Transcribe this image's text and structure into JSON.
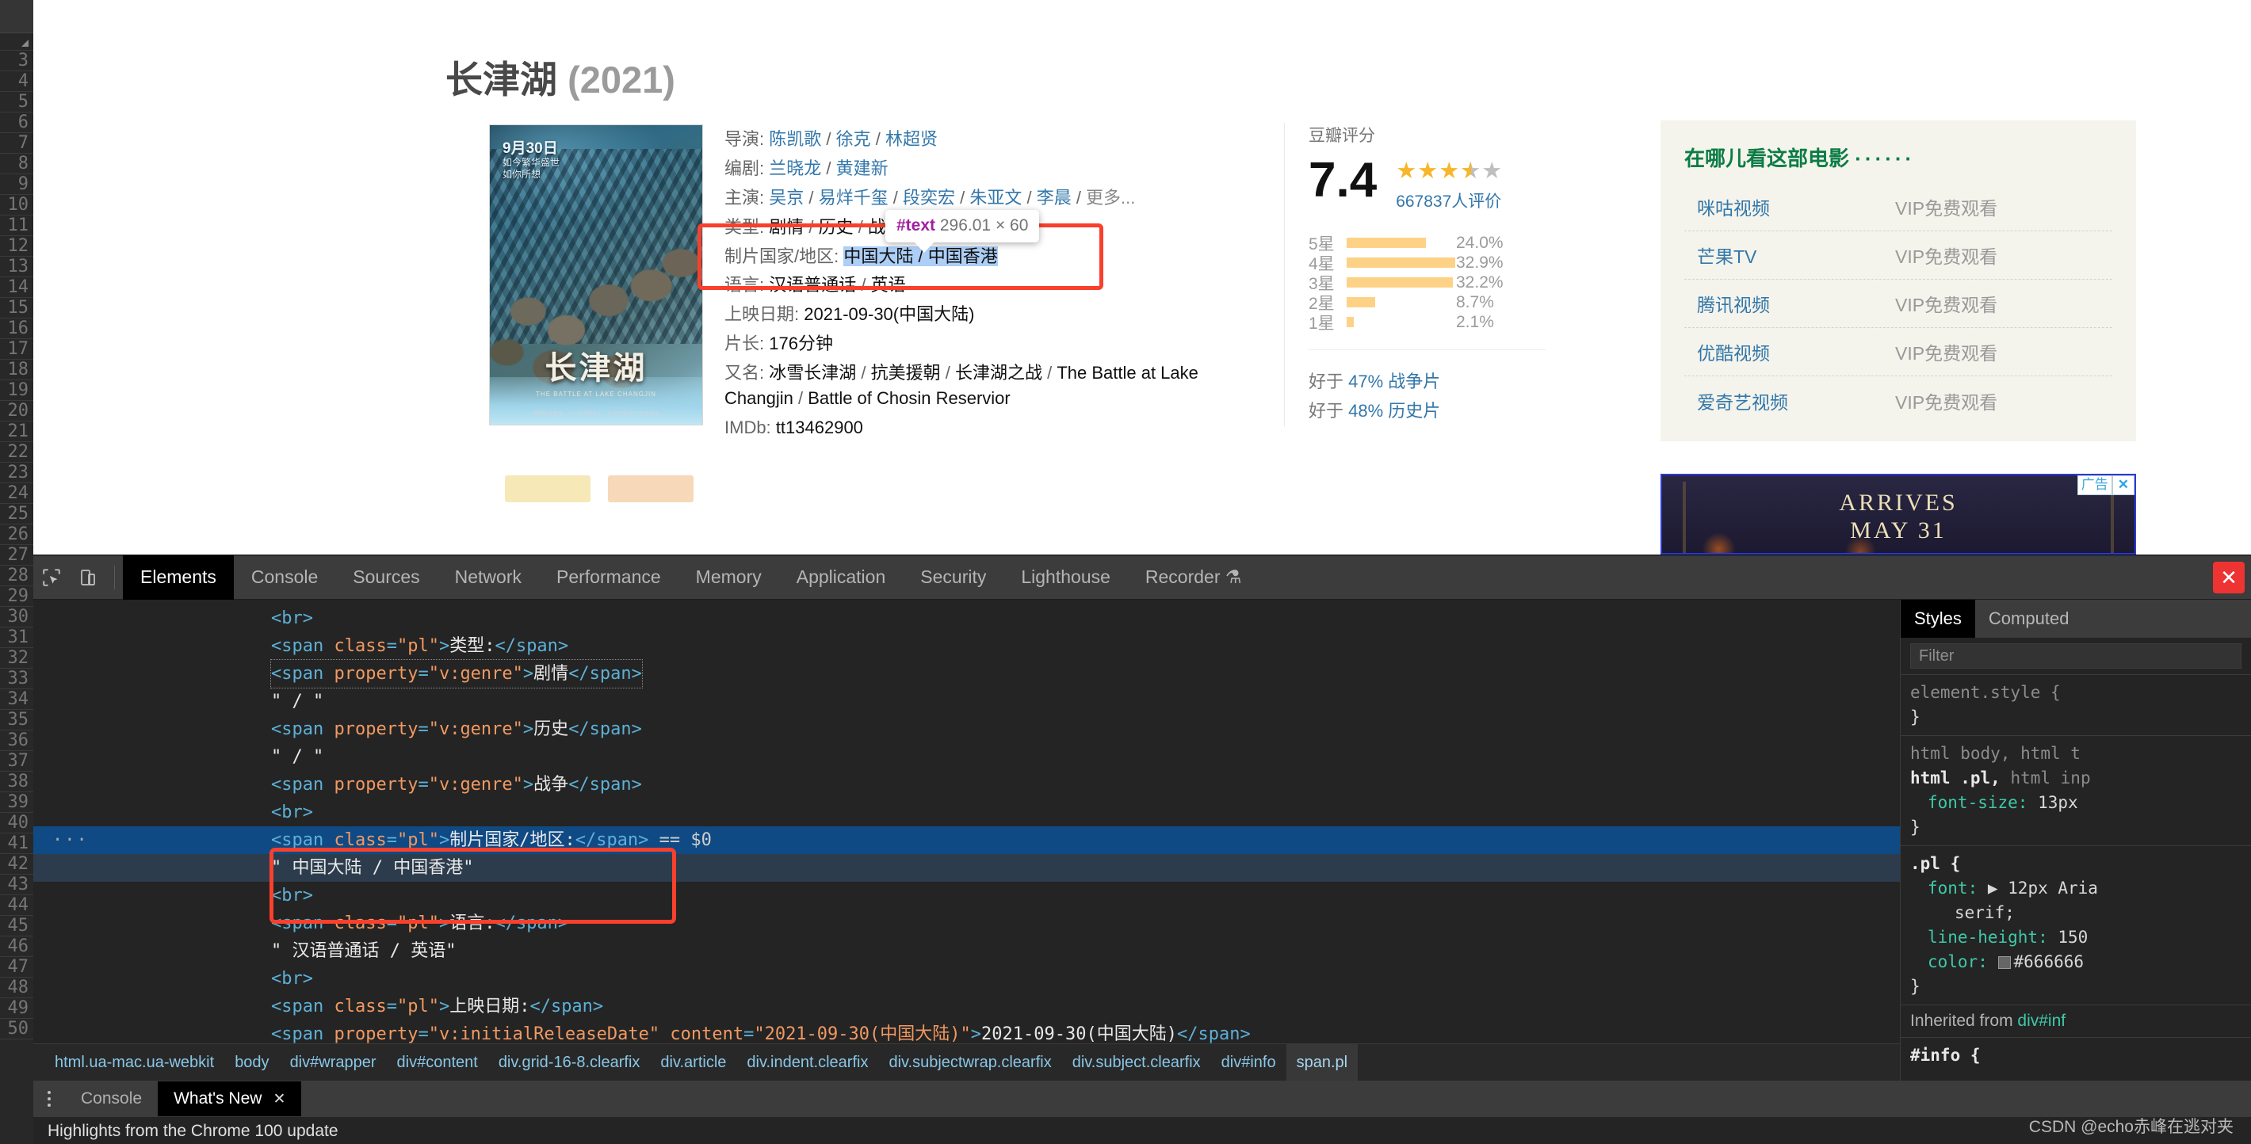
{
  "page": {
    "title_zh": "长津湖",
    "title_year": "(2021)",
    "poster": {
      "date": "9月30日",
      "tagline_line1": "如今繁华盛世",
      "tagline_line2": "如你所想",
      "logo": "长津湖",
      "english": "THE BATTLE AT LAKE CHANGJIN",
      "credits": "博纳影业集团 · 八一电影制片厂 · 华夏电影发行 联合出品"
    },
    "info": [
      {
        "label": "导演:",
        "values": [
          "陈凯歌",
          "徐克",
          "林超贤"
        ],
        "link": true
      },
      {
        "label": "编剧:",
        "values": [
          "兰晓龙",
          "黄建新"
        ],
        "link": true
      },
      {
        "label": "主演:",
        "values": [
          "吴京",
          "易烊千玺",
          "段奕宏",
          "朱亚文",
          "李晨"
        ],
        "more": "更多...",
        "link": true
      },
      {
        "label": "类型:",
        "values": [
          "剧情",
          "历史",
          "战争"
        ],
        "link": false
      },
      {
        "label": "制片国家/地区:",
        "values": [
          "中国大陆",
          "中国香港"
        ],
        "link": false,
        "selected": true
      },
      {
        "label": "语言:",
        "values": [
          "汉语普通话",
          "英语"
        ],
        "link": false
      },
      {
        "label": "上映日期:",
        "values": [
          "2021-09-30(中国大陆)"
        ],
        "link": false
      },
      {
        "label": "片长:",
        "values": [
          "176分钟"
        ],
        "link": false
      },
      {
        "label": "又名:",
        "values": [
          "冰雪长津湖",
          "抗美援朝",
          "长津湖之战",
          "The Battle at Lake Changjin",
          "Battle of Chosin Reservior"
        ],
        "link": false
      },
      {
        "label": "IMDb:",
        "values": [
          "tt13462900"
        ],
        "link": false
      }
    ],
    "tooltip": {
      "node_name": "#text",
      "dimensions": "296.01 × 60"
    },
    "rating": {
      "heading": "豆瓣评分",
      "score": "7.4",
      "stars_filled": 3,
      "stars_half": 1,
      "stars_empty": 1,
      "count_label": "667837人评价",
      "distribution": [
        {
          "label": "5星",
          "percent": "24.0%",
          "width": 24.0
        },
        {
          "label": "4星",
          "percent": "32.9%",
          "width": 32.9
        },
        {
          "label": "3星",
          "percent": "32.2%",
          "width": 32.2
        },
        {
          "label": "2星",
          "percent": "8.7%",
          "width": 8.7
        },
        {
          "label": "1星",
          "percent": "2.1%",
          "width": 2.1
        }
      ],
      "better_than": [
        {
          "prefix": "好于",
          "value": "47%",
          "suffix": "战争片"
        },
        {
          "prefix": "好于",
          "value": "48%",
          "suffix": "历史片"
        }
      ]
    },
    "watch": {
      "title": "在哪儿看这部电影",
      "dots": "······",
      "rows": [
        {
          "name": "咪咕视频",
          "price": "VIP免费观看"
        },
        {
          "name": "芒果TV",
          "price": "VIP免费观看"
        },
        {
          "name": "腾讯视频",
          "price": "VIP免费观看"
        },
        {
          "name": "优酷视频",
          "price": "VIP免费观看"
        },
        {
          "name": "爱奇艺视频",
          "price": "VIP免费观看"
        }
      ]
    },
    "ad": {
      "line1": "ARRIVES",
      "line2": "MAY 31",
      "badge": "广告",
      "close": "✕"
    }
  },
  "devtools": {
    "tabs": [
      "Elements",
      "Console",
      "Sources",
      "Network",
      "Performance",
      "Memory",
      "Application",
      "Security",
      "Lighthouse",
      "Recorder"
    ],
    "active_tab": "Elements",
    "recorder_suffix": "⚗",
    "close_icon": "✕",
    "gutter_numbers": [
      "3",
      "4",
      "5",
      "6",
      "7",
      "8",
      "9",
      "10",
      "11",
      "12",
      "13",
      "14",
      "15",
      "16",
      "17",
      "18",
      "19",
      "20",
      "21",
      "22",
      "23",
      "24",
      "25",
      "26",
      "27",
      "28",
      "29",
      "30",
      "31",
      "32",
      "33",
      "34",
      "35",
      "36",
      "37",
      "38",
      "39",
      "40",
      "41",
      "42",
      "43",
      "44",
      "45",
      "46",
      "47",
      "48",
      "49",
      "50"
    ],
    "dom": {
      "lines": [
        {
          "n": 26,
          "html": "<span class=\"tag\">&lt;br&gt;</span>",
          "state": "dim"
        },
        {
          "n": 27,
          "html": "<span class=\"tag\">&lt;span </span><span class=\"attr\">class</span><span class=\"tag\">=</span><span class=\"val\">\"pl\"</span><span class=\"tag\">&gt;</span><span class=\"txt\">类型:</span><span class=\"tag\">&lt;/span&gt;</span>"
        },
        {
          "n": 28,
          "html": "<span class=\"dotted\"><span class=\"tag\">&lt;span </span><span class=\"attr\">property</span><span class=\"tag\">=</span><span class=\"val\">\"v:genre\"</span><span class=\"tag\">&gt;</span><span class=\"txt\">剧情</span><span class=\"tag\">&lt;/span&gt;</span></span>"
        },
        {
          "n": 29,
          "html": "<span class=\"txt\">\" / \"</span>"
        },
        {
          "n": 31,
          "html": "<span class=\"tag\">&lt;span </span><span class=\"attr\">property</span><span class=\"tag\">=</span><span class=\"val\">\"v:genre\"</span><span class=\"tag\">&gt;</span><span class=\"txt\">历史</span><span class=\"tag\">&lt;/span&gt;</span>"
        },
        {
          "n": 32,
          "html": "<span class=\"txt\">\" / \"</span>"
        },
        {
          "n": 33,
          "html": "<span class=\"tag\">&lt;span </span><span class=\"attr\">property</span><span class=\"tag\">=</span><span class=\"val\">\"v:genre\"</span><span class=\"tag\">&gt;</span><span class=\"txt\">战争</span><span class=\"tag\">&lt;/span&gt;</span>"
        },
        {
          "n": 34,
          "html": "<span class=\"tag\">&lt;br&gt;</span>"
        },
        {
          "n": 36,
          "html": "<span class=\"tag\">&lt;span </span><span class=\"attr\">class</span><span class=\"tag\">=</span><span class=\"val\">\"pl\"</span><span class=\"tag\">&gt;</span><span class=\"txt\">制片国家/地区:</span><span class=\"tag\">&lt;/span&gt;</span> <span class=\"dollar\">== $0</span>",
          "state": "selected",
          "ellipsis": "···"
        },
        {
          "n": 37,
          "html": "<span class=\"txt\">\" 中国大陆 / 中国香港\"</span>",
          "state": "selected2"
        },
        {
          "n": 38,
          "html": "<span class=\"tag\">&lt;br&gt;</span>"
        },
        {
          "n": 39,
          "html": "<span class=\"tag\">&lt;span </span><span class=\"attr\">class</span><span class=\"tag\">=</span><span class=\"val\">\"pl\"</span><span class=\"tag\">&gt;</span><span class=\"txt\">语言:</span><span class=\"tag\">&lt;/span&gt;</span>"
        },
        {
          "n": 41,
          "html": "<span class=\"txt\">\" 汉语普通话 / 英语\"</span>"
        },
        {
          "n": 42,
          "html": "<span class=\"tag\">&lt;br&gt;</span>"
        },
        {
          "n": 43,
          "html": "<span class=\"tag\">&lt;span </span><span class=\"attr\">class</span><span class=\"tag\">=</span><span class=\"val\">\"pl\"</span><span class=\"tag\">&gt;</span><span class=\"txt\">上映日期:</span><span class=\"tag\">&lt;/span&gt;</span>"
        },
        {
          "n": 44,
          "html": "<span class=\"tag\">&lt;span </span><span class=\"attr\">property</span><span class=\"tag\">=</span><span class=\"val\">\"v:initialReleaseDate\"</span><span class=\"tag\"> </span><span class=\"attr\">content</span><span class=\"tag\">=</span><span class=\"val\">\"2021-09-30(中国大陆)\"</span><span class=\"tag\">&gt;</span><span class=\"txt\">2021-09-30(中国大陆)</span><span class=\"tag\">&lt;/span&gt;</span>"
        }
      ]
    },
    "breadcrumb": [
      "html.ua-mac.ua-webkit",
      "body",
      "div#wrapper",
      "div#content",
      "div.grid-16-8.clearfix",
      "div.article",
      "div.indent.clearfix",
      "div.subjectwrap.clearfix",
      "div.subject.clearfix",
      "div#info",
      "span.pl"
    ],
    "breadcrumb_active": "span.pl",
    "styles": {
      "tabs": [
        "Styles",
        "Computed"
      ],
      "active_tab": "Styles",
      "filter_placeholder": "Filter",
      "blocks": [
        {
          "selector_html": "<span class=\"sel-dim\">element.style {</span>",
          "decls": [],
          "close": "}"
        },
        {
          "selector_html": "<span class=\"sel-dim\">html body, html t</span><br><span class=\"sel-on\">html .pl,</span> <span class=\"sel-dim\">html inp</span>",
          "decls": [
            {
              "prop": "font-size:",
              "value": "13px"
            }
          ],
          "close": "}"
        },
        {
          "selector_html": "<span class=\"sel-on\">.pl {</span>",
          "decls": [
            {
              "prop": "font:",
              "value": "▶ 12px Aria",
              "cont": "serif;"
            },
            {
              "prop": "line-height:",
              "value": "150"
            },
            {
              "prop": "color:",
              "value": "#666666",
              "swatch": true
            }
          ],
          "close": "}"
        }
      ],
      "inherited_label": "Inherited from",
      "inherited_target": "div#inf",
      "last_selector": "#info {"
    },
    "drawer": {
      "tabs": [
        {
          "label": "Console",
          "active": false
        },
        {
          "label": "What's New",
          "active": true,
          "closable": true
        }
      ],
      "close_icon": "✕",
      "body_text": "Highlights from the Chrome 100 update"
    },
    "watermark": "CSDN @echo赤峰在逃对夹"
  }
}
